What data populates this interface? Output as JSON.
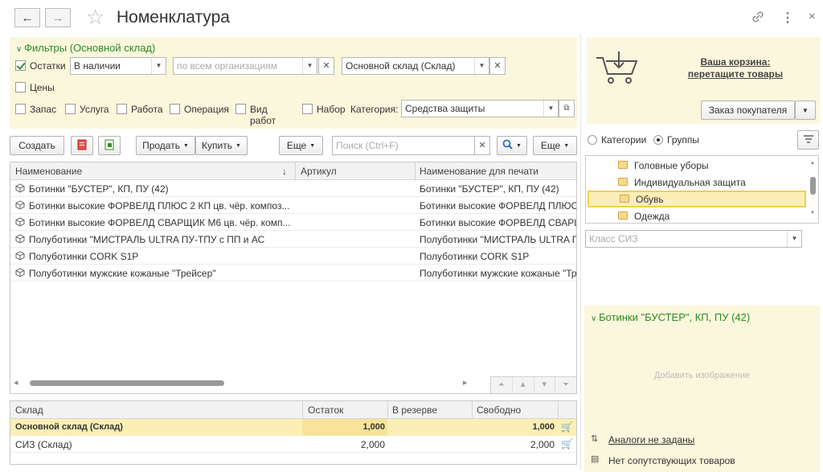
{
  "window": {
    "title": "Номенклатура",
    "back_icon": "←",
    "forward_icon": "→",
    "star_icon": "☆",
    "link_icon": "🔗",
    "more_icon": "⋮",
    "close_icon": "×"
  },
  "filters": {
    "title": "Фильтры (Основной склад)",
    "ostatki": {
      "label": "Остатки",
      "checked": true,
      "value": "В наличии"
    },
    "org_placeholder": "по всем организациям",
    "warehouse_value": "Основной склад (Склад)",
    "prices_label": "Цены",
    "types": [
      "Запас",
      "Услуга",
      "Работа",
      "Операция",
      "Вид работ"
    ],
    "set_label": "Набор",
    "category_label": "Категория:",
    "category_value": "Средства защиты"
  },
  "toolbar": {
    "create_label": "Создать",
    "sell_label": "Продать",
    "buy_label": "Купить",
    "more_label": "Еще",
    "search_placeholder": "Поиск (Ctrl+F)",
    "more2_label": "Еще"
  },
  "grid": {
    "columns": [
      "Наименование",
      "Артикул",
      "Наименование для печати"
    ],
    "rows": [
      {
        "name": "Ботинки \"БУСТЕР\", КП, ПУ (42)",
        "article": "",
        "print_name": "Ботинки \"БУСТЕР\", КП, ПУ (42)"
      },
      {
        "name": "Ботинки высокие ФОРВЕЛД ПЛЮС 2 КП цв. чёр. композ...",
        "article": "",
        "print_name": "Ботинки высокие ФОРВЕЛД ПЛЮС"
      },
      {
        "name": "Ботинки высокие ФОРВЕЛД СВАРЩИК М6 цв. чёр. комп...",
        "article": "",
        "print_name": "Ботинки высокие ФОРВЕЛД СВАРЩ"
      },
      {
        "name": "Полуботинки \"МИСТРАЛЬ ULTRA ПУ-ТПУ с ПП и АС",
        "article": "",
        "print_name": "Полуботинки \"МИСТРАЛЬ ULTRA ПУ"
      },
      {
        "name": "Полуботинки CORK S1P",
        "article": "",
        "print_name": "Полуботинки CORK S1P"
      },
      {
        "name": "Полуботинки мужские кожаные \"Трейсер\"",
        "article": "",
        "print_name": "Полуботинки мужские кожаные \"Тре"
      }
    ]
  },
  "stock": {
    "columns": [
      "Склад",
      "Остаток",
      "В резерве",
      "Свободно"
    ],
    "rows": [
      {
        "warehouse": "Основной склад (Склад)",
        "remain": "1,000",
        "reserve": "",
        "free": "1,000"
      },
      {
        "warehouse": "СИЗ (Склад)",
        "remain": "2,000",
        "reserve": "",
        "free": "2,000"
      }
    ]
  },
  "cart": {
    "line1": "Ваша корзина:",
    "line2": "перетащите товары",
    "order_button": "Заказ покупателя"
  },
  "tree": {
    "radio_categories": "Категории",
    "radio_groups": "Группы",
    "items": [
      "Головные уборы",
      "Индивидуальная защита",
      "Обувь",
      "Одежда"
    ],
    "selected_index": 2
  },
  "class_siz_placeholder": "Класс СИЗ",
  "details": {
    "title": "Ботинки \"БУСТЕР\", КП, ПУ (42)",
    "add_image": "Добавить изображение",
    "analogs_link": "Аналоги не заданы",
    "related": "Нет сопутствующих товаров"
  }
}
